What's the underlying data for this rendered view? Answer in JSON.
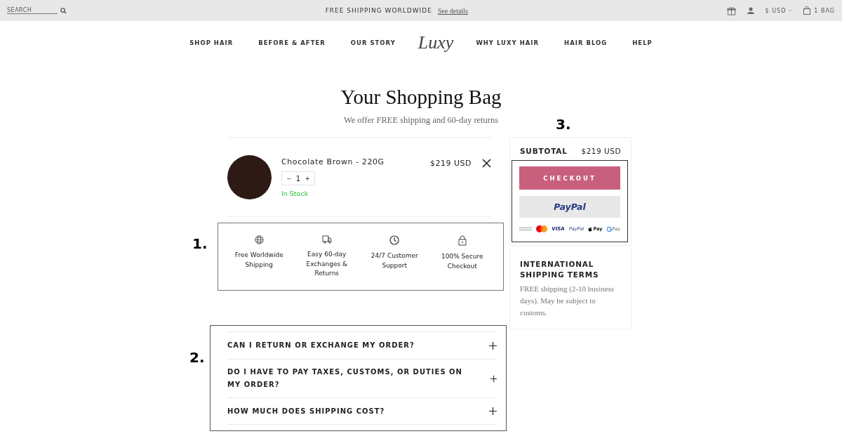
{
  "top_bar": {
    "search": {
      "placeholder": "SEARCH"
    },
    "promo": "FREE SHIPPING WORLDWIDE",
    "promo_link": "See details",
    "currency": "$ USD",
    "bag": "1 BAG"
  },
  "nav": {
    "left": [
      "SHOP HAIR",
      "BEFORE & AFTER",
      "OUR STORY"
    ],
    "logo": "Luxy",
    "right": [
      "WHY LUXY HAIR",
      "HAIR BLOG",
      "HELP"
    ]
  },
  "heading": "Your Shopping Bag",
  "subheading": "We offer FREE shipping and 60-day returns",
  "cart_items": [
    {
      "name": "Chocolate Brown - 220G",
      "quantity": "1",
      "minus": "−",
      "plus": "+",
      "stock": "In Stock",
      "price": "$219 USD"
    }
  ],
  "features": [
    {
      "kind": "globe",
      "label": "Free Worldwide Shipping"
    },
    {
      "kind": "truck",
      "label": "Easy 60-day Exchanges & Returns"
    },
    {
      "kind": "clock",
      "label": "24/7 Customer Support"
    },
    {
      "kind": "lock",
      "label": "100% Secure Checkout"
    }
  ],
  "faq": [
    {
      "question": "CAN I RETURN OR EXCHANGE MY ORDER?",
      "expanded": false
    },
    {
      "question": "DO I HAVE TO PAY TAXES, CUSTOMS, OR DUTIES ON MY ORDER?",
      "expanded": false
    },
    {
      "question": "HOW MUCH DOES SHIPPING COST?",
      "expanded": false
    }
  ],
  "summary": {
    "subtotal_label": "SUBTOTAL",
    "subtotal": "$219 USD",
    "checkout": "CHECKOUT",
    "paypal": "PayPal",
    "payment_methods": [
      {
        "kind": "amex"
      },
      {
        "kind": "mastercard"
      },
      {
        "kind": "text",
        "label": "VISA"
      },
      {
        "kind": "text",
        "label": "PayPal"
      },
      {
        "kind": "apple",
        "label": "Pay"
      },
      {
        "kind": "google",
        "label": "Pay"
      }
    ],
    "terms_title": "INTERNATIONAL SHIPPING TERMS",
    "terms_text": "FREE shipping (2-10 business days). May be subject to customs."
  },
  "annotations": [
    "1.",
    "2.",
    "3."
  ]
}
